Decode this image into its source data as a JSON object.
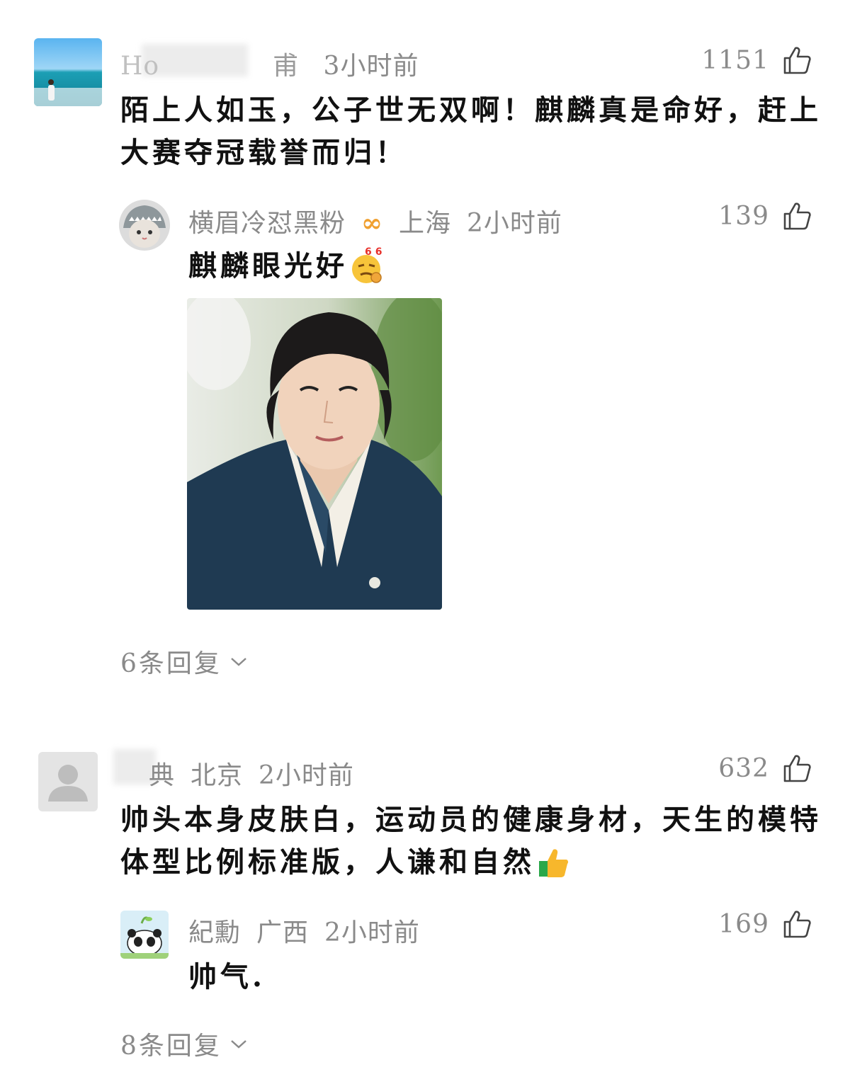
{
  "comments": [
    {
      "username": "Ho",
      "username_tail": "甫",
      "time": "3小时前",
      "likes": "1151",
      "text_lines": [
        "陌上人如玉，公子世无双啊！麒麟真是命好，赶上",
        "大赛夺冠载誉而归！"
      ],
      "reply": {
        "username": "横眉冷怼黑粉",
        "badge": "∞",
        "location": "上海",
        "time": "2小时前",
        "likes": "139",
        "text": "麒麟眼光好",
        "emoji_label": "666"
      },
      "replies_label": "6条回复"
    },
    {
      "username_tail": "典",
      "location": "北京",
      "time": "2小时前",
      "likes": "632",
      "text_lines": [
        "帅头本身皮肤白，运动员的健康身材，天生的模特",
        "体型比例标准版，人谦和自然"
      ],
      "reply": {
        "username": "紀勳",
        "location": "广西",
        "time": "2小时前",
        "likes": "169",
        "text": "帅气."
      },
      "replies_label": "8条回复"
    }
  ],
  "icons": {
    "like": "thumbs-up-icon",
    "expand": "chevron-down-icon"
  },
  "colors": {
    "meta": "#8a8a8a",
    "text": "#111111",
    "badge": "#f0a030"
  }
}
